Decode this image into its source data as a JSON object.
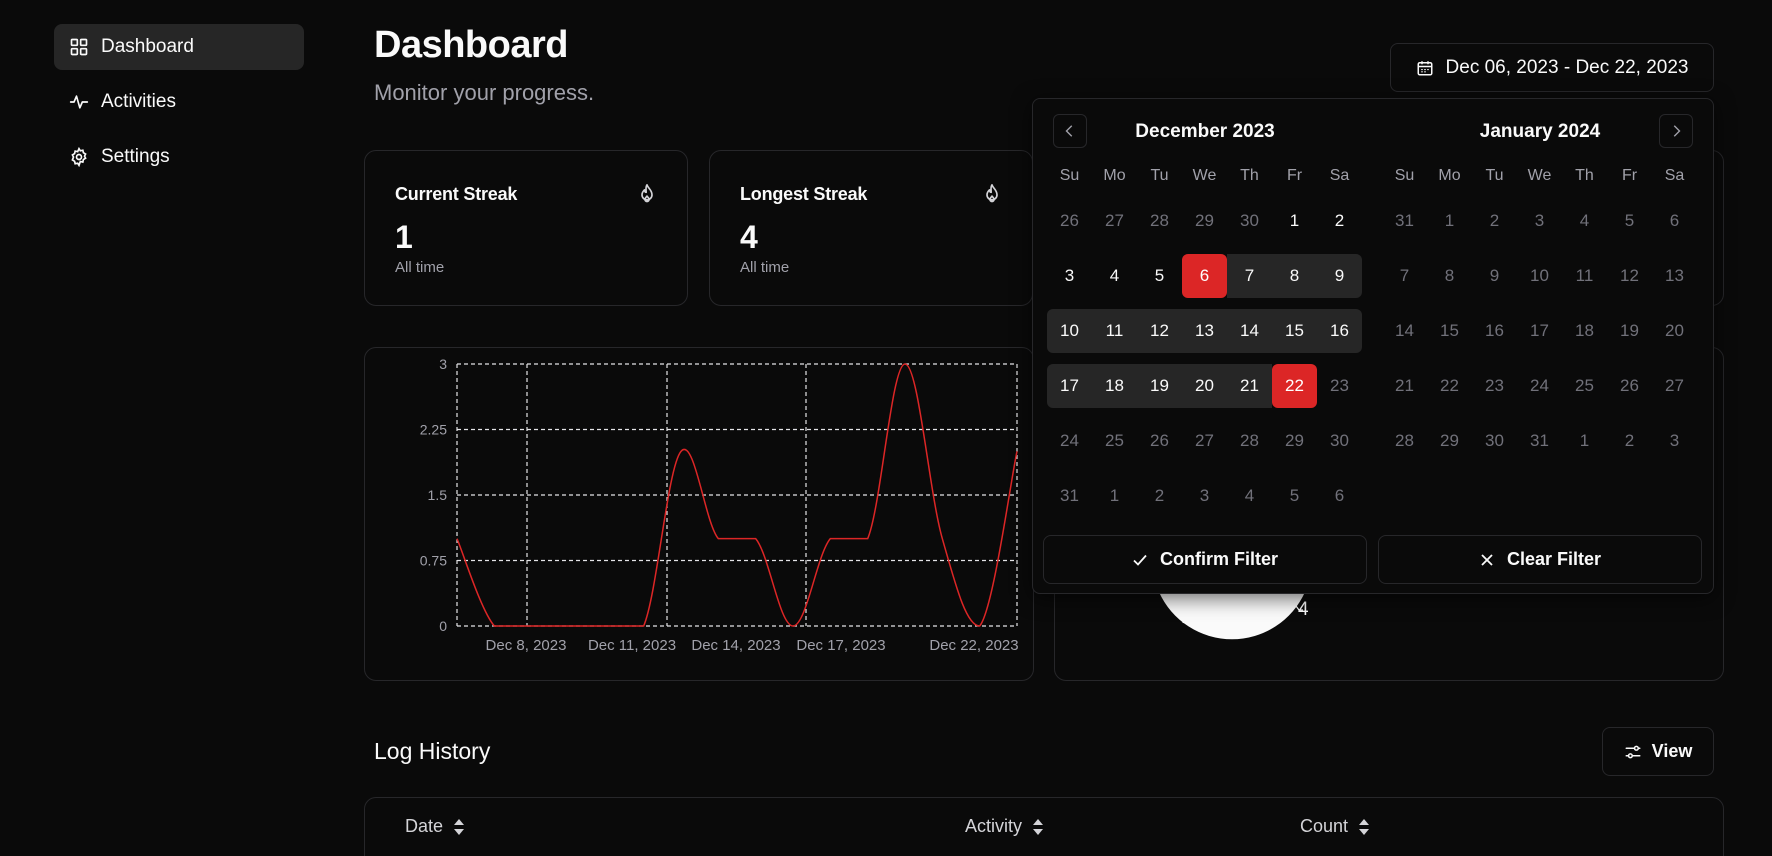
{
  "sidebar": {
    "items": [
      {
        "label": "Dashboard",
        "icon": "dashboard-grid-icon",
        "active": true
      },
      {
        "label": "Activities",
        "icon": "activity-pulse-icon",
        "active": false
      },
      {
        "label": "Settings",
        "icon": "gear-icon",
        "active": false
      }
    ]
  },
  "header": {
    "title": "Dashboard",
    "subtitle": "Monitor your progress.",
    "date_range": "Dec 06, 2023 - Dec 22, 2023"
  },
  "stats": [
    {
      "title": "Current Streak",
      "value": "1",
      "caption": "All time",
      "icon": "flame-icon"
    },
    {
      "title": "Longest Streak",
      "value": "4",
      "caption": "All time",
      "icon": "flame-icon"
    }
  ],
  "chart_data": {
    "type": "line",
    "x": [
      "Dec 6, 2023",
      "Dec 7, 2023",
      "Dec 8, 2023",
      "Dec 9, 2023",
      "Dec 10, 2023",
      "Dec 11, 2023",
      "Dec 12, 2023",
      "Dec 13, 2023",
      "Dec 14, 2023",
      "Dec 15, 2023",
      "Dec 16, 2023",
      "Dec 17, 2023",
      "Dec 18, 2023",
      "Dec 19, 2023",
      "Dec 20, 2023",
      "Dec 21, 2023",
      "Dec 22, 2023"
    ],
    "y": [
      1,
      0,
      0,
      0,
      0,
      0,
      2,
      1,
      1,
      0,
      1,
      1,
      3,
      1,
      0,
      2
    ],
    "x_tick_labels": [
      "Dec 8, 2023",
      "Dec 11, 2023",
      "Dec 14, 2023",
      "Dec 17, 2023",
      "Dec 22, 2023"
    ],
    "y_ticks": [
      "0",
      "0.75",
      "1.5",
      "2.25",
      "3"
    ],
    "ylim": [
      0,
      3
    ],
    "grid": true,
    "color": "#dc2626"
  },
  "pie": {
    "visible_label": "4"
  },
  "calendar": {
    "months": [
      {
        "title": "December 2023",
        "weekdays": [
          "Su",
          "Mo",
          "Tu",
          "We",
          "Th",
          "Fr",
          "Sa"
        ],
        "weeks": [
          [
            {
              "d": "26",
              "m": true
            },
            {
              "d": "27",
              "m": true
            },
            {
              "d": "28",
              "m": true
            },
            {
              "d": "29",
              "m": true
            },
            {
              "d": "30",
              "m": true
            },
            {
              "d": "1"
            },
            {
              "d": "2"
            }
          ],
          [
            {
              "d": "3"
            },
            {
              "d": "4"
            },
            {
              "d": "5"
            },
            {
              "d": "6",
              "s": true
            },
            {
              "d": "7",
              "r": true
            },
            {
              "d": "8",
              "r": true
            },
            {
              "d": "9",
              "r": true
            }
          ],
          [
            {
              "d": "10",
              "r": true
            },
            {
              "d": "11",
              "r": true
            },
            {
              "d": "12",
              "r": true
            },
            {
              "d": "13",
              "r": true
            },
            {
              "d": "14",
              "r": true
            },
            {
              "d": "15",
              "r": true
            },
            {
              "d": "16",
              "r": true
            }
          ],
          [
            {
              "d": "17",
              "r": true
            },
            {
              "d": "18",
              "r": true
            },
            {
              "d": "19",
              "r": true
            },
            {
              "d": "20",
              "r": true
            },
            {
              "d": "21",
              "r": true
            },
            {
              "d": "22",
              "s": true
            },
            {
              "d": "23",
              "m": true
            }
          ],
          [
            {
              "d": "24",
              "m": true
            },
            {
              "d": "25",
              "m": true
            },
            {
              "d": "26",
              "m": true
            },
            {
              "d": "27",
              "m": true
            },
            {
              "d": "28",
              "m": true
            },
            {
              "d": "29",
              "m": true
            },
            {
              "d": "30",
              "m": true
            }
          ],
          [
            {
              "d": "31",
              "m": true
            },
            {
              "d": "1",
              "m": true
            },
            {
              "d": "2",
              "m": true
            },
            {
              "d": "3",
              "m": true
            },
            {
              "d": "4",
              "m": true
            },
            {
              "d": "5",
              "m": true
            },
            {
              "d": "6",
              "m": true
            }
          ]
        ]
      },
      {
        "title": "January 2024",
        "weekdays": [
          "Su",
          "Mo",
          "Tu",
          "We",
          "Th",
          "Fr",
          "Sa"
        ],
        "weeks": [
          [
            {
              "d": "31",
              "m": true
            },
            {
              "d": "1",
              "m": true
            },
            {
              "d": "2",
              "m": true
            },
            {
              "d": "3",
              "m": true
            },
            {
              "d": "4",
              "m": true
            },
            {
              "d": "5",
              "m": true
            },
            {
              "d": "6",
              "m": true
            }
          ],
          [
            {
              "d": "7",
              "m": true
            },
            {
              "d": "8",
              "m": true
            },
            {
              "d": "9",
              "m": true
            },
            {
              "d": "10",
              "m": true
            },
            {
              "d": "11",
              "m": true
            },
            {
              "d": "12",
              "m": true
            },
            {
              "d": "13",
              "m": true
            }
          ],
          [
            {
              "d": "14",
              "m": true
            },
            {
              "d": "15",
              "m": true
            },
            {
              "d": "16",
              "m": true
            },
            {
              "d": "17",
              "m": true
            },
            {
              "d": "18",
              "m": true
            },
            {
              "d": "19",
              "m": true
            },
            {
              "d": "20",
              "m": true
            }
          ],
          [
            {
              "d": "21",
              "m": true
            },
            {
              "d": "22",
              "m": true
            },
            {
              "d": "23",
              "m": true
            },
            {
              "d": "24",
              "m": true
            },
            {
              "d": "25",
              "m": true
            },
            {
              "d": "26",
              "m": true
            },
            {
              "d": "27",
              "m": true
            }
          ],
          [
            {
              "d": "28",
              "m": true
            },
            {
              "d": "29",
              "m": true
            },
            {
              "d": "30",
              "m": true
            },
            {
              "d": "31",
              "m": true
            },
            {
              "d": "1",
              "m": true
            },
            {
              "d": "2",
              "m": true
            },
            {
              "d": "3",
              "m": true
            }
          ]
        ]
      }
    ],
    "confirm_label": "Confirm Filter",
    "clear_label": "Clear Filter"
  },
  "log": {
    "title": "Log History",
    "view_label": "View",
    "columns": [
      "Date",
      "Activity",
      "Count"
    ]
  },
  "colors": {
    "accent": "#dc2626",
    "range": "#262626",
    "border": "#27272a"
  }
}
